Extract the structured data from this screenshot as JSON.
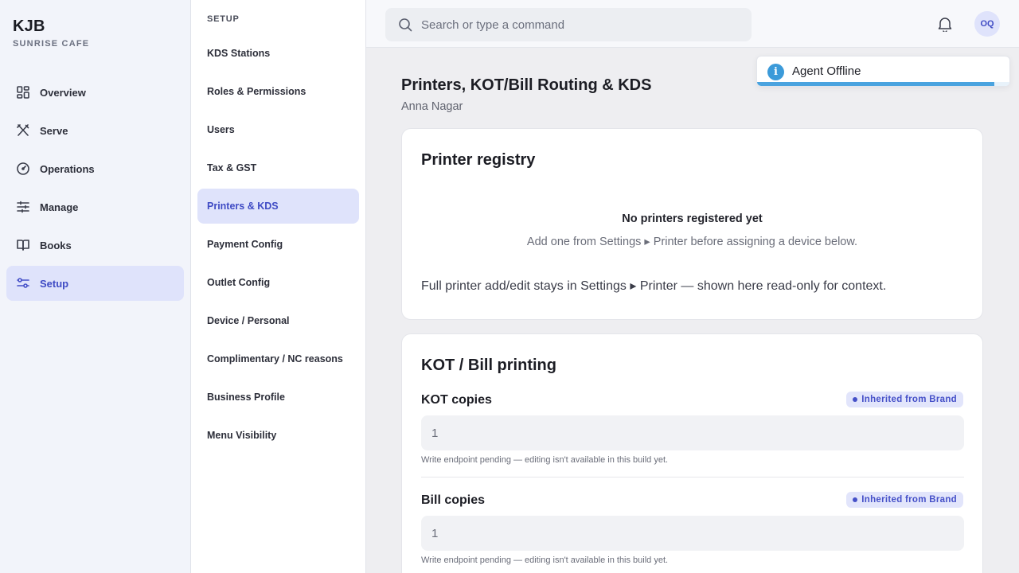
{
  "brand": {
    "name": "KJB",
    "subtitle": "SUNRISE CAFE"
  },
  "nav": {
    "items": [
      {
        "label": "Overview",
        "icon": "overview-icon",
        "active": false
      },
      {
        "label": "Serve",
        "icon": "utensils-icon",
        "active": false
      },
      {
        "label": "Operations",
        "icon": "gauge-icon",
        "active": false
      },
      {
        "label": "Manage",
        "icon": "sliders-icon",
        "active": false
      },
      {
        "label": "Books",
        "icon": "book-icon",
        "active": false
      },
      {
        "label": "Setup",
        "icon": "settings-sliders-icon",
        "active": true
      }
    ]
  },
  "subnav": {
    "title": "SETUP",
    "items": [
      {
        "label": "KDS Stations",
        "active": false
      },
      {
        "label": "Roles & Permissions",
        "active": false
      },
      {
        "label": "Users",
        "active": false
      },
      {
        "label": "Tax & GST",
        "active": false
      },
      {
        "label": "Printers & KDS",
        "active": true
      },
      {
        "label": "Payment Config",
        "active": false
      },
      {
        "label": "Outlet Config",
        "active": false
      },
      {
        "label": "Device / Personal",
        "active": false
      },
      {
        "label": "Complimentary / NC reasons",
        "active": false
      },
      {
        "label": "Business Profile",
        "active": false
      },
      {
        "label": "Menu Visibility",
        "active": false
      }
    ]
  },
  "topbar": {
    "search_placeholder": "Search or type a command",
    "avatar_initials": "OQ"
  },
  "toast": {
    "message": "Agent Offline",
    "progress": 0.94,
    "accent": "#4aa3df"
  },
  "page": {
    "title": "Printers, KOT/Bill Routing & KDS",
    "subtitle": "Anna Nagar"
  },
  "registry": {
    "title": "Printer registry",
    "empty_title": "No printers registered yet",
    "empty_desc": "Add one from Settings ▸ Printer before assigning a device below.",
    "note": "Full printer add/edit stays in Settings ▸ Printer — shown here read-only for context."
  },
  "printing": {
    "title": "KOT / Bill printing",
    "fields": [
      {
        "label": "KOT copies",
        "badge": "Inherited from Brand",
        "value": "1",
        "hint": "Write endpoint pending — editing isn't available in this build yet."
      },
      {
        "label": "Bill copies",
        "badge": "Inherited from Brand",
        "value": "1",
        "hint": "Write endpoint pending — editing isn't available in this build yet."
      }
    ]
  },
  "colors": {
    "accent": "#4550c8",
    "active_bg": "#dfe3fb"
  }
}
